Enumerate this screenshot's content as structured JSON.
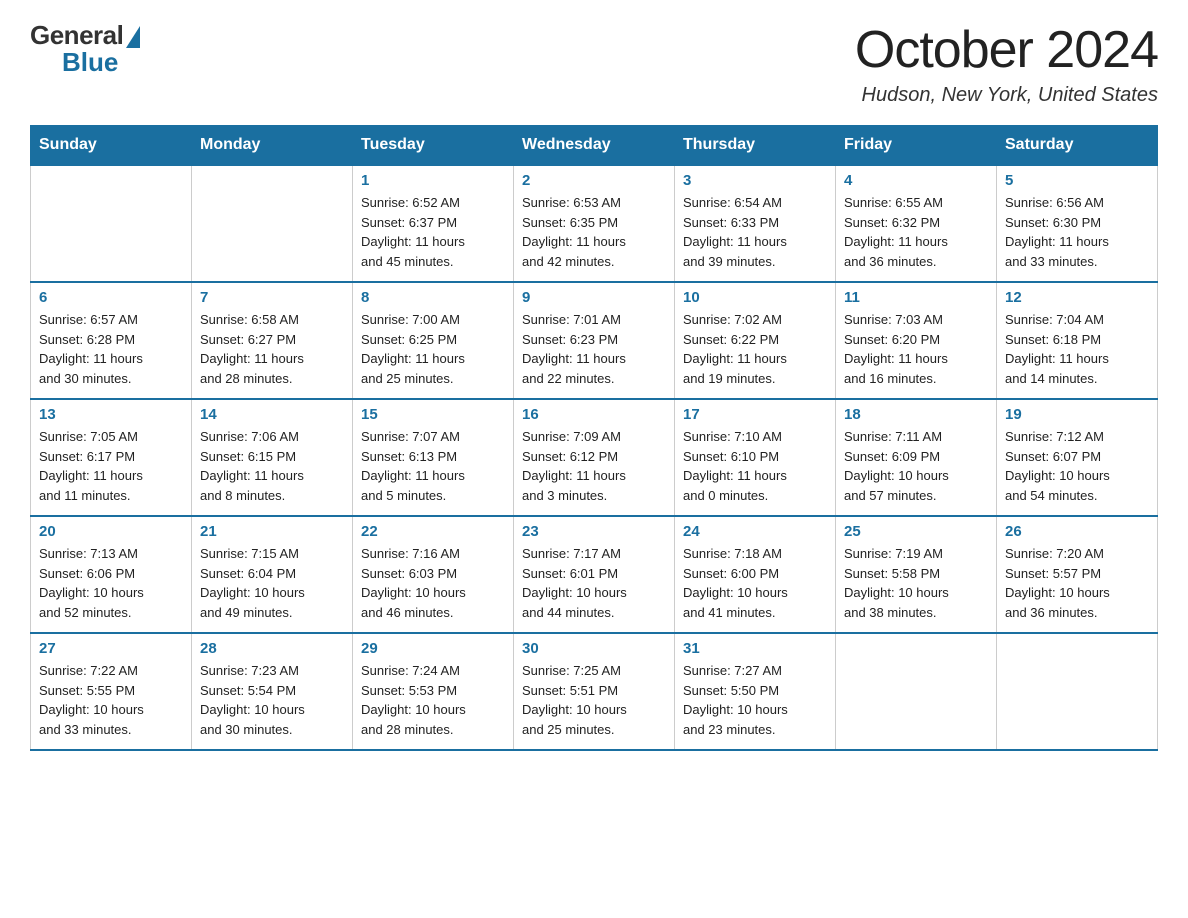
{
  "header": {
    "logo_general": "General",
    "logo_blue": "Blue",
    "month_title": "October 2024",
    "location": "Hudson, New York, United States"
  },
  "weekdays": [
    "Sunday",
    "Monday",
    "Tuesday",
    "Wednesday",
    "Thursday",
    "Friday",
    "Saturday"
  ],
  "rows": [
    [
      {
        "day": "",
        "info": ""
      },
      {
        "day": "",
        "info": ""
      },
      {
        "day": "1",
        "info": "Sunrise: 6:52 AM\nSunset: 6:37 PM\nDaylight: 11 hours\nand 45 minutes."
      },
      {
        "day": "2",
        "info": "Sunrise: 6:53 AM\nSunset: 6:35 PM\nDaylight: 11 hours\nand 42 minutes."
      },
      {
        "day": "3",
        "info": "Sunrise: 6:54 AM\nSunset: 6:33 PM\nDaylight: 11 hours\nand 39 minutes."
      },
      {
        "day": "4",
        "info": "Sunrise: 6:55 AM\nSunset: 6:32 PM\nDaylight: 11 hours\nand 36 minutes."
      },
      {
        "day": "5",
        "info": "Sunrise: 6:56 AM\nSunset: 6:30 PM\nDaylight: 11 hours\nand 33 minutes."
      }
    ],
    [
      {
        "day": "6",
        "info": "Sunrise: 6:57 AM\nSunset: 6:28 PM\nDaylight: 11 hours\nand 30 minutes."
      },
      {
        "day": "7",
        "info": "Sunrise: 6:58 AM\nSunset: 6:27 PM\nDaylight: 11 hours\nand 28 minutes."
      },
      {
        "day": "8",
        "info": "Sunrise: 7:00 AM\nSunset: 6:25 PM\nDaylight: 11 hours\nand 25 minutes."
      },
      {
        "day": "9",
        "info": "Sunrise: 7:01 AM\nSunset: 6:23 PM\nDaylight: 11 hours\nand 22 minutes."
      },
      {
        "day": "10",
        "info": "Sunrise: 7:02 AM\nSunset: 6:22 PM\nDaylight: 11 hours\nand 19 minutes."
      },
      {
        "day": "11",
        "info": "Sunrise: 7:03 AM\nSunset: 6:20 PM\nDaylight: 11 hours\nand 16 minutes."
      },
      {
        "day": "12",
        "info": "Sunrise: 7:04 AM\nSunset: 6:18 PM\nDaylight: 11 hours\nand 14 minutes."
      }
    ],
    [
      {
        "day": "13",
        "info": "Sunrise: 7:05 AM\nSunset: 6:17 PM\nDaylight: 11 hours\nand 11 minutes."
      },
      {
        "day": "14",
        "info": "Sunrise: 7:06 AM\nSunset: 6:15 PM\nDaylight: 11 hours\nand 8 minutes."
      },
      {
        "day": "15",
        "info": "Sunrise: 7:07 AM\nSunset: 6:13 PM\nDaylight: 11 hours\nand 5 minutes."
      },
      {
        "day": "16",
        "info": "Sunrise: 7:09 AM\nSunset: 6:12 PM\nDaylight: 11 hours\nand 3 minutes."
      },
      {
        "day": "17",
        "info": "Sunrise: 7:10 AM\nSunset: 6:10 PM\nDaylight: 11 hours\nand 0 minutes."
      },
      {
        "day": "18",
        "info": "Sunrise: 7:11 AM\nSunset: 6:09 PM\nDaylight: 10 hours\nand 57 minutes."
      },
      {
        "day": "19",
        "info": "Sunrise: 7:12 AM\nSunset: 6:07 PM\nDaylight: 10 hours\nand 54 minutes."
      }
    ],
    [
      {
        "day": "20",
        "info": "Sunrise: 7:13 AM\nSunset: 6:06 PM\nDaylight: 10 hours\nand 52 minutes."
      },
      {
        "day": "21",
        "info": "Sunrise: 7:15 AM\nSunset: 6:04 PM\nDaylight: 10 hours\nand 49 minutes."
      },
      {
        "day": "22",
        "info": "Sunrise: 7:16 AM\nSunset: 6:03 PM\nDaylight: 10 hours\nand 46 minutes."
      },
      {
        "day": "23",
        "info": "Sunrise: 7:17 AM\nSunset: 6:01 PM\nDaylight: 10 hours\nand 44 minutes."
      },
      {
        "day": "24",
        "info": "Sunrise: 7:18 AM\nSunset: 6:00 PM\nDaylight: 10 hours\nand 41 minutes."
      },
      {
        "day": "25",
        "info": "Sunrise: 7:19 AM\nSunset: 5:58 PM\nDaylight: 10 hours\nand 38 minutes."
      },
      {
        "day": "26",
        "info": "Sunrise: 7:20 AM\nSunset: 5:57 PM\nDaylight: 10 hours\nand 36 minutes."
      }
    ],
    [
      {
        "day": "27",
        "info": "Sunrise: 7:22 AM\nSunset: 5:55 PM\nDaylight: 10 hours\nand 33 minutes."
      },
      {
        "day": "28",
        "info": "Sunrise: 7:23 AM\nSunset: 5:54 PM\nDaylight: 10 hours\nand 30 minutes."
      },
      {
        "day": "29",
        "info": "Sunrise: 7:24 AM\nSunset: 5:53 PM\nDaylight: 10 hours\nand 28 minutes."
      },
      {
        "day": "30",
        "info": "Sunrise: 7:25 AM\nSunset: 5:51 PM\nDaylight: 10 hours\nand 25 minutes."
      },
      {
        "day": "31",
        "info": "Sunrise: 7:27 AM\nSunset: 5:50 PM\nDaylight: 10 hours\nand 23 minutes."
      },
      {
        "day": "",
        "info": ""
      },
      {
        "day": "",
        "info": ""
      }
    ]
  ]
}
